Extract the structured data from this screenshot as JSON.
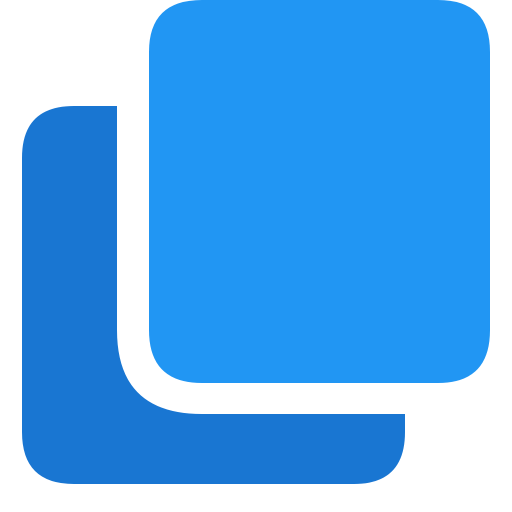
{
  "icon": {
    "name": "copy-icon",
    "colors": {
      "back": "#1976D2",
      "front": "#2196F3",
      "background": "#FFFFFF"
    }
  }
}
